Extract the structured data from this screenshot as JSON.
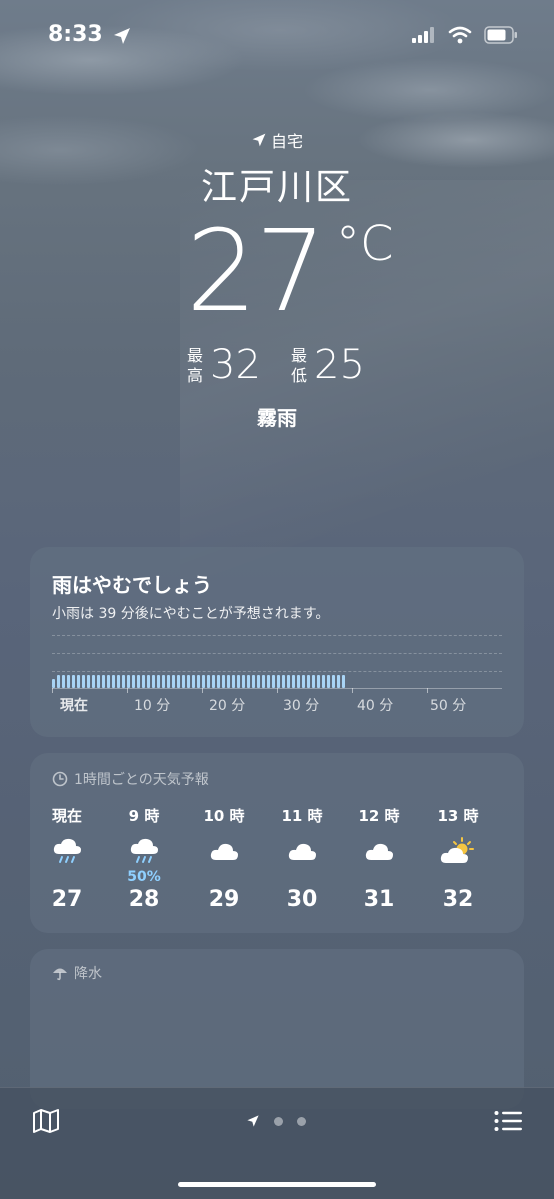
{
  "status_bar": {
    "time": "8:33"
  },
  "location": {
    "label": "自宅",
    "city": "江戸川区",
    "temperature": "27",
    "unit": "°C",
    "high_label_1": "最",
    "high_label_2": "高",
    "high": "32",
    "low_label_1": "最",
    "low_label_2": "低",
    "low": "25",
    "condition": "霧雨"
  },
  "precip_card": {
    "title": "雨はやむでしょう",
    "subtitle": "小雨は 39 分後にやむことが予想されます。",
    "axis_labels": [
      "現在",
      "10 分",
      "20 分",
      "30 分",
      "40 分",
      "50 分"
    ],
    "rain_minutes": 39
  },
  "hourly_card": {
    "header": "1時間ごとの天気予報",
    "hours": [
      {
        "label": "現在",
        "icon": "rain-cloud-icon",
        "pop": "",
        "temp": "27"
      },
      {
        "label": "9 時",
        "icon": "rain-cloud-icon",
        "pop": "50%",
        "temp": "28"
      },
      {
        "label": "10 時",
        "icon": "cloud-icon",
        "pop": "",
        "temp": "29"
      },
      {
        "label": "11 時",
        "icon": "cloud-icon",
        "pop": "",
        "temp": "30"
      },
      {
        "label": "12 時",
        "icon": "cloud-icon",
        "pop": "",
        "temp": "31"
      },
      {
        "label": "13 時",
        "icon": "partly-sunny-icon",
        "pop": "",
        "temp": "32"
      }
    ]
  },
  "precipitation_card": {
    "header": "降水"
  },
  "colors": {
    "rain_bar": "#a9d4f5",
    "pop_text": "#8fd0ff",
    "sun": "#f5c542"
  }
}
